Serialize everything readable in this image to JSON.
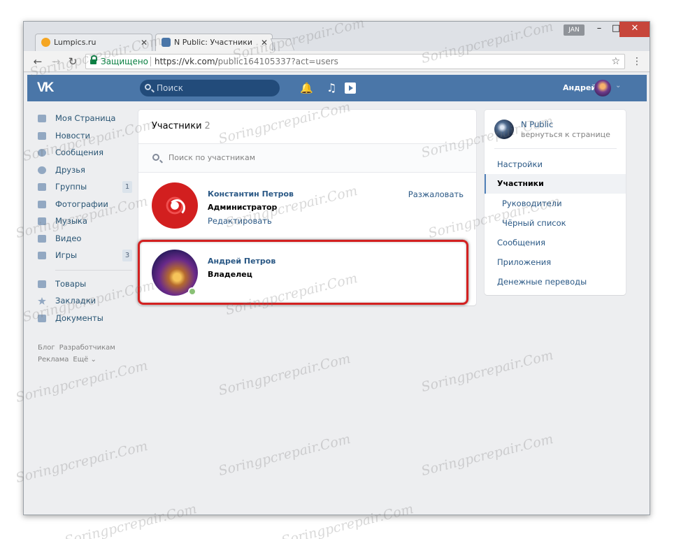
{
  "browser": {
    "tabs": [
      {
        "title": "Lumpics.ru",
        "favicon_color": "#f5a623",
        "active": false
      },
      {
        "title": "N Public: Участники",
        "favicon_color": "#4a76a8",
        "active": true
      }
    ],
    "profile_badge": "JAN",
    "window_controls": {
      "minimize": "–",
      "maximize": "□",
      "close": "✕"
    },
    "tab_close": "✕",
    "nav": {
      "back": "←",
      "forward": "→",
      "reload": "↻"
    },
    "secure_label": "Защищено",
    "url_host": "https://vk.com/",
    "url_path": "public164105337?act=users",
    "bookmark_star": "☆",
    "menu_dots": "⋮"
  },
  "vk_header": {
    "logo": "VK",
    "search_placeholder": "Поиск",
    "bell": "🔔",
    "music": "♫",
    "user_name": "Андрей",
    "chevron": "⌄"
  },
  "left_nav": {
    "items": [
      {
        "label": "Моя Страница",
        "icon": "home-icon"
      },
      {
        "label": "Новости",
        "icon": "news-icon"
      },
      {
        "label": "Сообщения",
        "icon": "messages-icon"
      },
      {
        "label": "Друзья",
        "icon": "friends-icon"
      },
      {
        "label": "Группы",
        "icon": "groups-icon",
        "badge": "1"
      },
      {
        "label": "Фотографии",
        "icon": "camera-icon"
      },
      {
        "label": "Музыка",
        "icon": "music-icon"
      },
      {
        "label": "Видео",
        "icon": "video-icon"
      },
      {
        "label": "Игры",
        "icon": "gamepad-icon",
        "badge": "3"
      }
    ],
    "items2": [
      {
        "label": "Товары",
        "icon": "bag-icon"
      },
      {
        "label": "Закладки",
        "icon": "star-icon"
      },
      {
        "label": "Документы",
        "icon": "document-icon"
      }
    ],
    "footer": {
      "blog": "Блог",
      "developers": "Разработчикам",
      "ads": "Реклама",
      "more": "Ещё ⌄"
    }
  },
  "members": {
    "title": "Участники",
    "count": "2",
    "search_placeholder": "Поиск по участникам",
    "list": [
      {
        "name": "Константин Петров",
        "role": "Администратор",
        "edit": "Редактировать",
        "action": "Разжаловать"
      },
      {
        "name": "Андрей Петров",
        "role": "Владелец"
      }
    ]
  },
  "right_panel": {
    "group_name": "N Public",
    "back_link": "вернуться к странице",
    "menu": [
      {
        "label": "Настройки"
      },
      {
        "label": "Участники",
        "active": true
      },
      {
        "label": "Руководители",
        "sub": true
      },
      {
        "label": "Чёрный список",
        "sub": true
      },
      {
        "label": "Сообщения"
      },
      {
        "label": "Приложения"
      },
      {
        "label": "Денежные переводы"
      }
    ]
  },
  "watermark": "Soringpcrepair.Com",
  "colors": {
    "vk_blue": "#4a76a8",
    "link": "#2a5885",
    "highlight_red": "#d32020",
    "online": "#8ac176"
  }
}
